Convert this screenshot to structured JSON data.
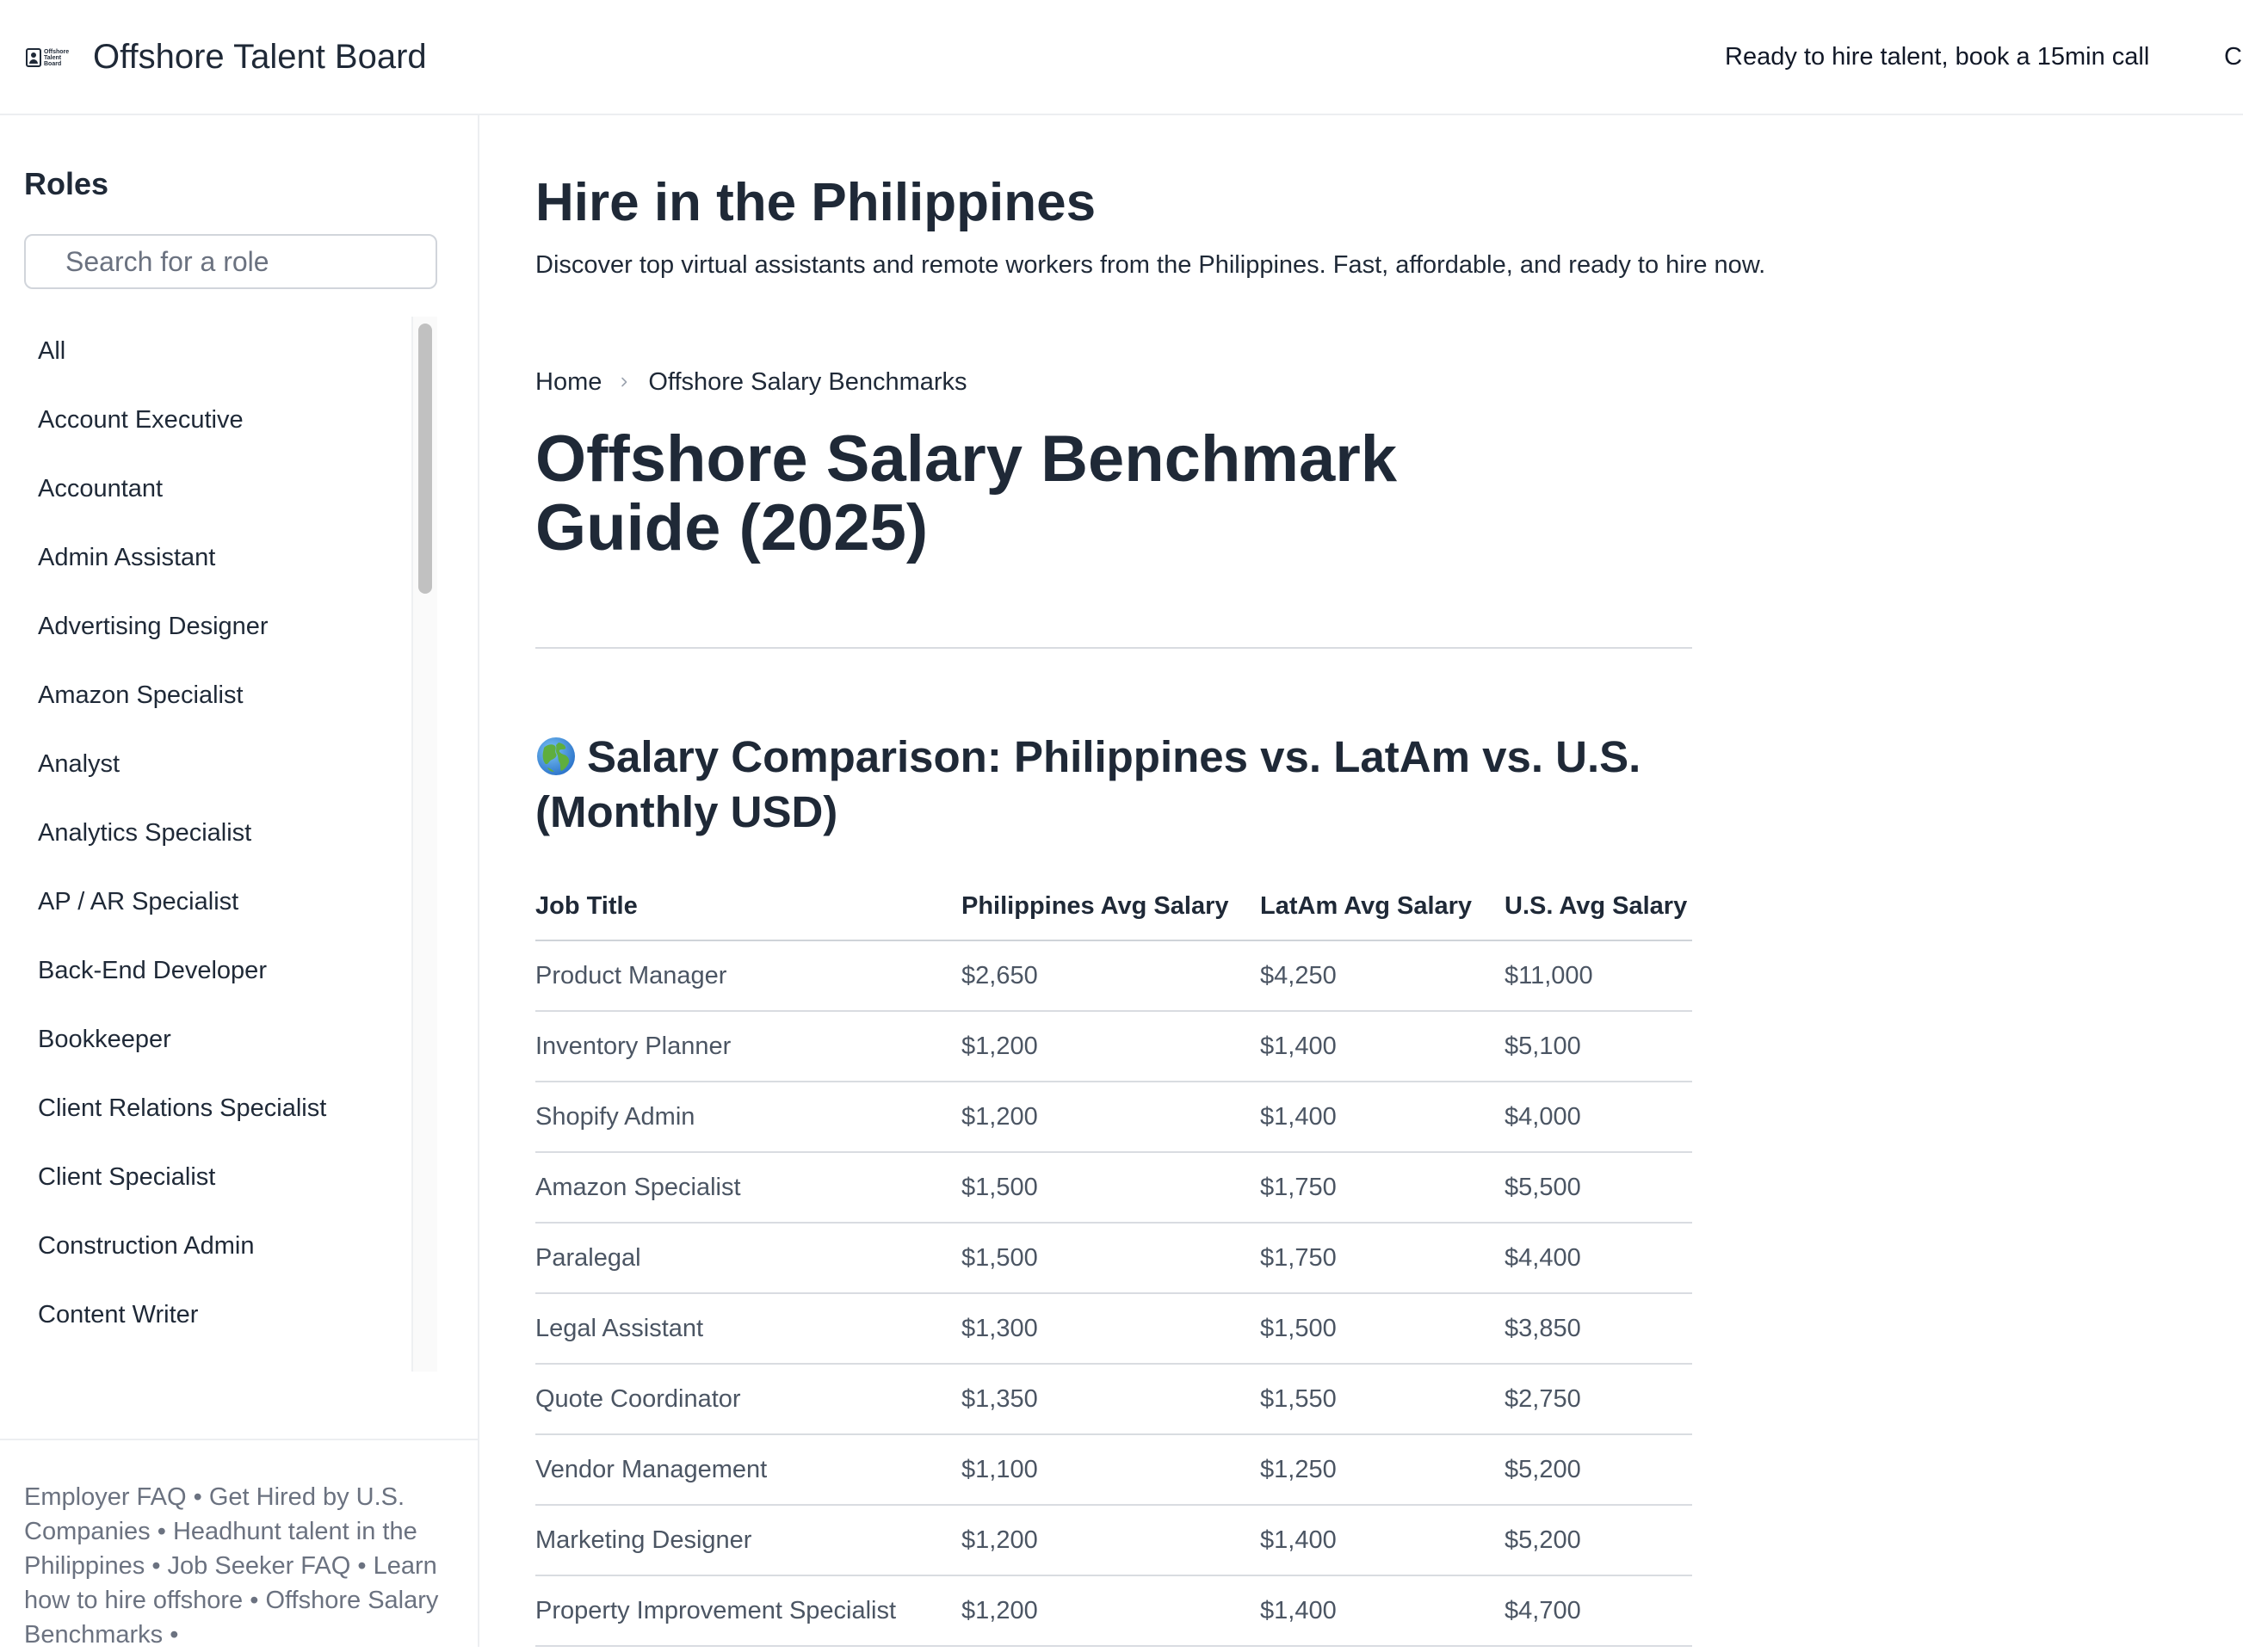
{
  "header": {
    "logo_text": "Offshore Talent Board",
    "brand": "Offshore Talent Board",
    "cta": "Ready to hire talent, book a 15min call",
    "clipped_link": "Ca"
  },
  "sidebar": {
    "title": "Roles",
    "search_placeholder": "Search for a role",
    "items": [
      "All",
      "Account Executive",
      "Accountant",
      "Admin Assistant",
      "Advertising Designer",
      "Amazon Specialist",
      "Analyst",
      "Analytics Specialist",
      "AP / AR Specialist",
      "Back-End Developer",
      "Bookkeeper",
      "Client Relations Specialist",
      "Client Specialist",
      "Construction Admin",
      "Content Writer"
    ],
    "footer_links": [
      "Employer FAQ",
      "Get Hired by U.S. Companies",
      "Headhunt talent in the Philippines",
      "Job Seeker FAQ",
      "Learn how to hire offshore",
      "Offshore Salary Benchmarks"
    ],
    "footer_separator": " • "
  },
  "main": {
    "heading": "Hire in the Philippines",
    "subheading": "Discover top virtual assistants and remote workers from the Philippines. Fast, affordable, and ready to hire now.",
    "breadcrumb": {
      "home": "Home",
      "current": "Offshore Salary Benchmarks"
    },
    "title": "Offshore Salary Benchmark Guide (2025)",
    "section_title": "Salary Comparison: Philippines vs. LatAm vs. U.S. (Monthly USD)",
    "section_icon": "globe-icon"
  },
  "table": {
    "headers": [
      "Job Title",
      "Philippines Avg Salary",
      "LatAm Avg Salary",
      "U.S. Avg Salary"
    ],
    "rows": [
      [
        "Product Manager",
        "$2,650",
        "$4,250",
        "$11,000"
      ],
      [
        "Inventory Planner",
        "$1,200",
        "$1,400",
        "$5,100"
      ],
      [
        "Shopify Admin",
        "$1,200",
        "$1,400",
        "$4,000"
      ],
      [
        "Amazon Specialist",
        "$1,500",
        "$1,750",
        "$5,500"
      ],
      [
        "Paralegal",
        "$1,500",
        "$1,750",
        "$4,400"
      ],
      [
        "Legal Assistant",
        "$1,300",
        "$1,500",
        "$3,850"
      ],
      [
        "Quote Coordinator",
        "$1,350",
        "$1,550",
        "$2,750"
      ],
      [
        "Vendor Management",
        "$1,100",
        "$1,250",
        "$5,200"
      ],
      [
        "Marketing Designer",
        "$1,200",
        "$1,400",
        "$5,200"
      ],
      [
        "Property Improvement Specialist",
        "$1,200",
        "$1,400",
        "$4,700"
      ]
    ]
  },
  "colors": {
    "text": "#1f2937",
    "muted": "#4b5563",
    "border": "#d9dce1"
  }
}
